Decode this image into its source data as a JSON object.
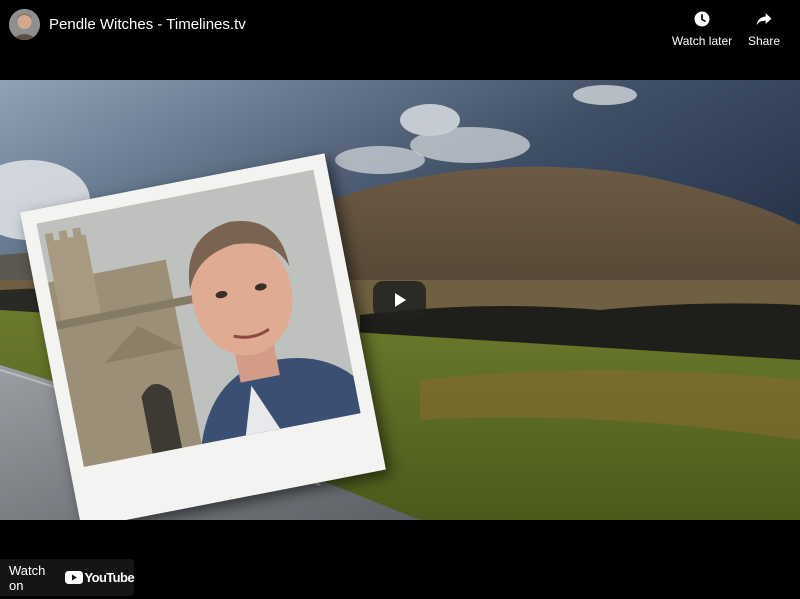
{
  "header": {
    "title": "Pendle Witches - Timelines.tv",
    "avatar_icon": "channel-avatar",
    "actions": [
      {
        "label": "Watch later",
        "icon": "clock-icon"
      },
      {
        "label": "Share",
        "icon": "share-arrow-icon"
      }
    ]
  },
  "player": {
    "play_icon": "play-icon",
    "watch_on_label": "Watch on",
    "brand": "YouTube",
    "brand_color": "#FF0000"
  }
}
